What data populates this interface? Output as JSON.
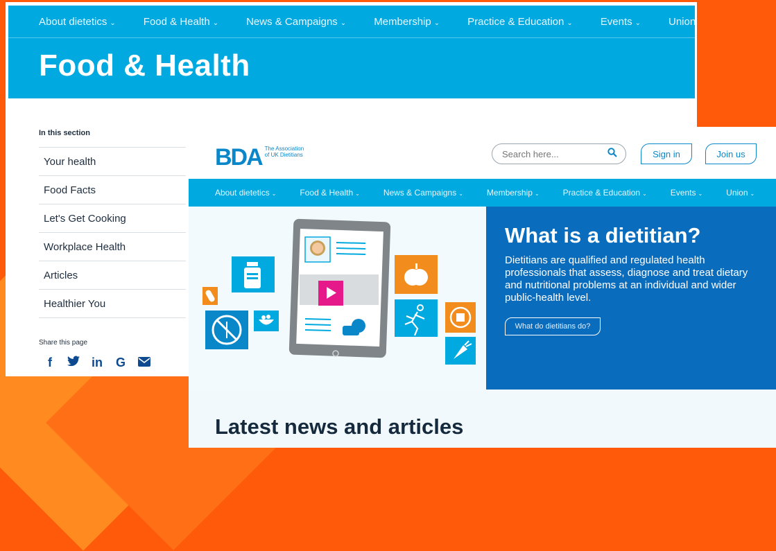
{
  "back_page": {
    "nav": [
      {
        "label": "About dietetics"
      },
      {
        "label": "Food & Health"
      },
      {
        "label": "News & Campaigns"
      },
      {
        "label": "Membership"
      },
      {
        "label": "Practice & Education"
      },
      {
        "label": "Events"
      },
      {
        "label": "Union"
      }
    ],
    "title": "Food & Health",
    "section_label": "In this section",
    "sidebar": [
      {
        "label": "Your health"
      },
      {
        "label": "Food Facts"
      },
      {
        "label": "Let's Get Cooking"
      },
      {
        "label": "Workplace Health"
      },
      {
        "label": "Articles"
      },
      {
        "label": "Healthier You"
      }
    ],
    "share_label": "Share this page",
    "share_icons": [
      "facebook-icon",
      "twitter-icon",
      "linkedin-icon",
      "google-icon",
      "email-icon"
    ]
  },
  "front_page": {
    "logo": {
      "mark": "BDA",
      "tagline_1": "The Association",
      "tagline_2": "of UK Dietitians"
    },
    "search": {
      "placeholder": "Search here..."
    },
    "sign_in": "Sign in",
    "join_us": "Join us",
    "nav": [
      {
        "label": "About dietetics"
      },
      {
        "label": "Food & Health"
      },
      {
        "label": "News & Campaigns"
      },
      {
        "label": "Membership"
      },
      {
        "label": "Practice & Education"
      },
      {
        "label": "Events"
      },
      {
        "label": "Union"
      }
    ],
    "hero": {
      "title": "What is a dietitian?",
      "text": "Dietitians are qualified and regulated health professionals that assess, diagnose and treat dietary and nutritional problems at an individual and wider public-health level.",
      "button": "What do dietitians do?"
    },
    "news_title": "Latest news and articles"
  },
  "colors": {
    "accent": "#00a9e0",
    "brand": "#0a87c9",
    "hero": "#0a6cbd",
    "background": "#ff5a0a",
    "play": "#e6198a",
    "orange_tile": "#f28c1c"
  }
}
